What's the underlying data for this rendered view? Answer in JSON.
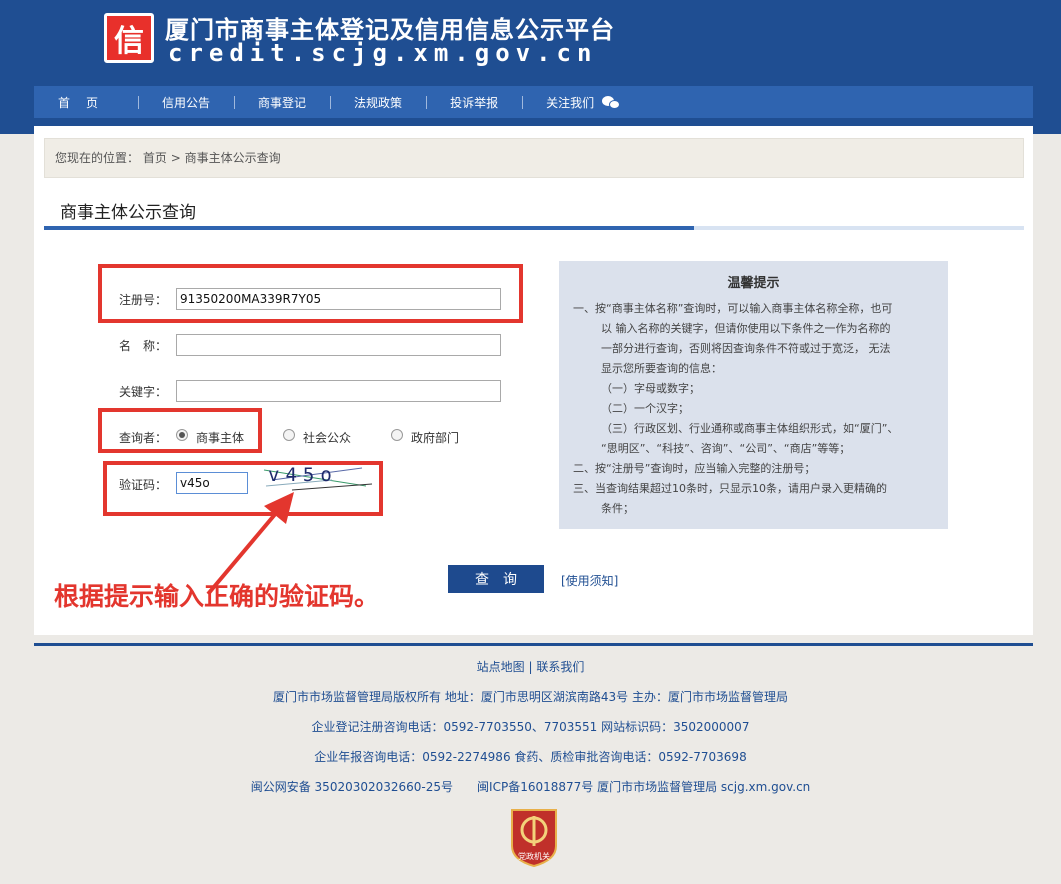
{
  "header": {
    "logo_text": "信",
    "title": "厦门市商事主体登记及信用信息公示平台",
    "url": "credit.scjg.xm.gov.cn"
  },
  "nav": {
    "items": [
      "首页",
      "信用公告",
      "商事登记",
      "法规政策",
      "投诉举报",
      "关注我们"
    ]
  },
  "breadcrumb": {
    "prefix": "您现在的位置：",
    "home": "首页",
    "separator": ">",
    "current": "商事主体公示查询"
  },
  "page_title": "商事主体公示查询",
  "form": {
    "reg_label": "注册号：",
    "reg_value": "91350200MA339R7Y05",
    "name_label": "名　称：",
    "name_value": "",
    "keyword_label": "关键字：",
    "keyword_value": "",
    "inquirer_label": "查询者：",
    "inquirer_options": [
      "商事主体",
      "社会公众",
      "政府部门"
    ],
    "inquirer_selected": "商事主体",
    "captcha_label": "验证码：",
    "captcha_value": "v45o",
    "captcha_image_text": "v45o"
  },
  "tips": {
    "title": "温馨提示",
    "lines": [
      "一、按“商事主体名称”查询时，可以输入商事主体名称全称，也可",
      "以 输入名称的关键字，但请你使用以下条件之一作为名称的",
      "一部分进行查询，否则将因查询条件不符或过于宽泛， 无法",
      "显示您所要查询的信息：",
      "（一）字母或数字；",
      "（二）一个汉字；",
      "（三）行政区划、行业通称或商事主体组织形式，如“厦门”、",
      "“思明区”、“科技”、咨询”、“公司”、“商店”等等；",
      "二、按“注册号”查询时，应当输入完整的注册号；",
      "三、当查询结果超过10条时，只显示10条，请用户录入更精确的",
      "条件；"
    ]
  },
  "search_button": "查询",
  "usage_link": "[使用须知]",
  "annotation": "根据提示输入正确的验证码。",
  "footer": {
    "sitemap": "站点地图",
    "divider": "|",
    "contact": "联系我们",
    "line1": "厦门市市场监督管理局版权所有 地址：厦门市思明区湖滨南路43号 主办：厦门市市场监督管理局",
    "line2": "企业登记注册咨询电话：0592-7703550、7703551 网站标识码：3502000007",
    "line3": "企业年报咨询电话：0592-2274986 食药、质检审批咨询电话：0592-7703698",
    "line4": "闽公网安备 35020302032660-25号　　闽ICP备16018877号 厦门市市场监督管理局 scjg.xm.gov.cn",
    "badge_text": "党政机关"
  },
  "colors": {
    "header_bg": "#1f4e92",
    "nav_bg": "#2f64b0",
    "annotation_red": "#e3362e",
    "tips_bg": "#dbe1ec"
  }
}
